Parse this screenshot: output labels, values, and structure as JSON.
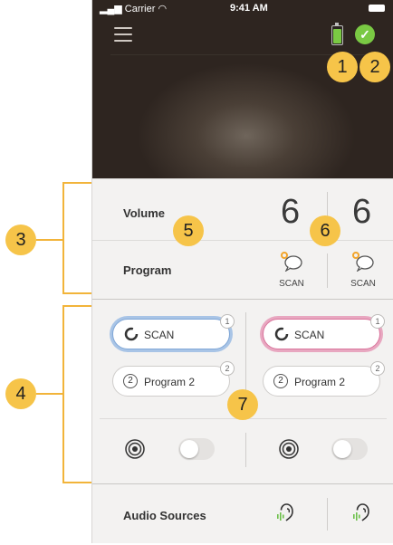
{
  "status": {
    "carrier": "Carrier",
    "time": "9:41 AM"
  },
  "volume": {
    "label": "Volume",
    "left": "6",
    "right": "6"
  },
  "program": {
    "label": "Program",
    "left_scan": "SCAN",
    "right_scan": "SCAN"
  },
  "programs": {
    "left": [
      {
        "label": "SCAN",
        "badge": "1"
      },
      {
        "label": "Program 2",
        "number": "2",
        "badge": "2"
      }
    ],
    "right": [
      {
        "label": "SCAN",
        "badge": "1"
      },
      {
        "label": "Program 2",
        "number": "2",
        "badge": "2"
      }
    ]
  },
  "audio": {
    "label": "Audio Sources"
  },
  "callouts": {
    "c1": "1",
    "c2": "2",
    "c3": "3",
    "c4": "4",
    "c5": "5",
    "c6": "6",
    "c7": "7"
  },
  "colors": {
    "accent_blue": "#7fa6d6",
    "accent_pink": "#d9739b",
    "callout": "#f6c449",
    "ok_green": "#7ac943"
  },
  "icons": [
    "menu-icon",
    "battery-icon",
    "check-icon",
    "scan-bubble-icon",
    "scan-ring-icon",
    "telecoil-icon",
    "ear-audio-icon"
  ]
}
